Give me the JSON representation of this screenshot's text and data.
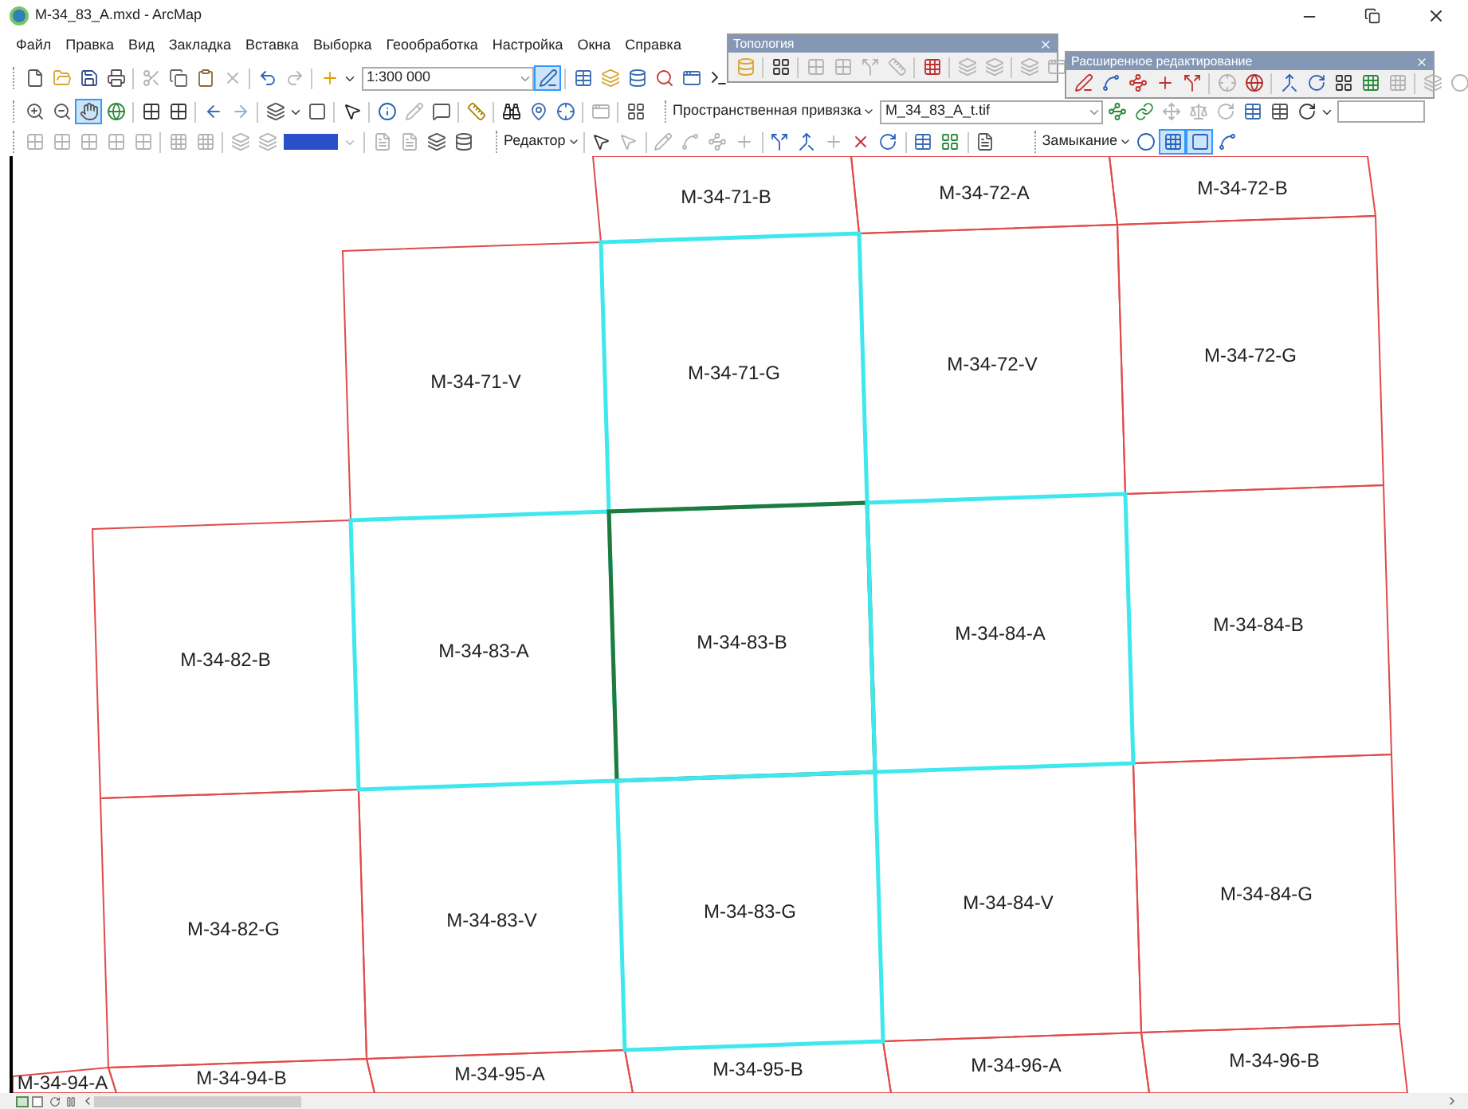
{
  "window": {
    "title": "M-34_83_A.mxd - ArcMap"
  },
  "menu": [
    "Файл",
    "Правка",
    "Вид",
    "Закладка",
    "Вставка",
    "Выборка",
    "Геообработка",
    "Настройка",
    "Окна",
    "Справка"
  ],
  "toolbars": {
    "editor_tool": {
      "selected": true
    },
    "scale": {
      "value": "1:300 000"
    },
    "pan_tool": {
      "selected": true
    },
    "georef_label": "Пространственная привязка",
    "georef_layer": {
      "value": "M_34_83_A_t.tif"
    },
    "editor_label": "Редактор",
    "snapping": {
      "label": "Замыкание",
      "modes": [
        {
          "selected": false
        },
        {
          "selected": true
        },
        {
          "selected": true
        },
        {
          "selected": false
        }
      ]
    }
  },
  "palettes": [
    {
      "title": "Топология"
    },
    {
      "title": "Расширенное редактирование"
    }
  ],
  "map": {
    "rows": [
      {
        "tiles": [
          {
            "label": "M-34-71-B",
            "color": "#e04a4a",
            "highlighted": false
          },
          {
            "label": "M-34-72-A",
            "color": "#e04a4a",
            "highlighted": false
          },
          {
            "label": "M-34-72-B",
            "color": "#e04a4a",
            "highlighted": false
          }
        ]
      },
      {
        "tiles": [
          {
            "label": "M-34-71-V",
            "color": "#e04a4a",
            "highlighted": false
          },
          {
            "label": "M-34-71-G",
            "color": "#3ee8ee",
            "highlighted": true
          },
          {
            "label": "M-34-72-V",
            "color": "#e04a4a",
            "highlighted": false
          },
          {
            "label": "M-34-72-G",
            "color": "#e04a4a",
            "highlighted": false
          }
        ]
      },
      {
        "tiles": [
          {
            "label": "M-34-82-B",
            "color": "#e04a4a",
            "highlighted": false
          },
          {
            "label": "M-34-83-A",
            "color": "#3ee8ee",
            "highlighted": true
          },
          {
            "label": "M-34-83-B",
            "color": "#1f7a3c",
            "highlighted": true
          },
          {
            "label": "M-34-84-A",
            "color": "#3ee8ee",
            "highlighted": true
          },
          {
            "label": "M-34-84-B",
            "color": "#e04a4a",
            "highlighted": false
          }
        ]
      },
      {
        "tiles": [
          {
            "label": "M-34-82-G",
            "color": "#e04a4a",
            "highlighted": false
          },
          {
            "label": "M-34-83-V",
            "color": "#e04a4a",
            "highlighted": false
          },
          {
            "label": "M-34-83-G",
            "color": "#3ee8ee",
            "highlighted": true
          },
          {
            "label": "M-34-84-V",
            "color": "#e04a4a",
            "highlighted": false
          },
          {
            "label": "M-34-84-G",
            "color": "#e04a4a",
            "highlighted": false
          }
        ]
      },
      {
        "tiles": [
          {
            "label": "M-34-94-A",
            "color": "#e04a4a",
            "highlighted": false
          },
          {
            "label": "M-34-94-B",
            "color": "#e04a4a",
            "highlighted": false
          },
          {
            "label": "M-34-95-A",
            "color": "#e04a4a",
            "highlighted": false
          },
          {
            "label": "M-34-95-B",
            "color": "#e04a4a",
            "highlighted": false
          },
          {
            "label": "M-34-96-A",
            "color": "#e04a4a",
            "highlighted": false
          },
          {
            "label": "M-34-96-B",
            "color": "#e04a4a",
            "highlighted": false
          }
        ]
      }
    ]
  }
}
